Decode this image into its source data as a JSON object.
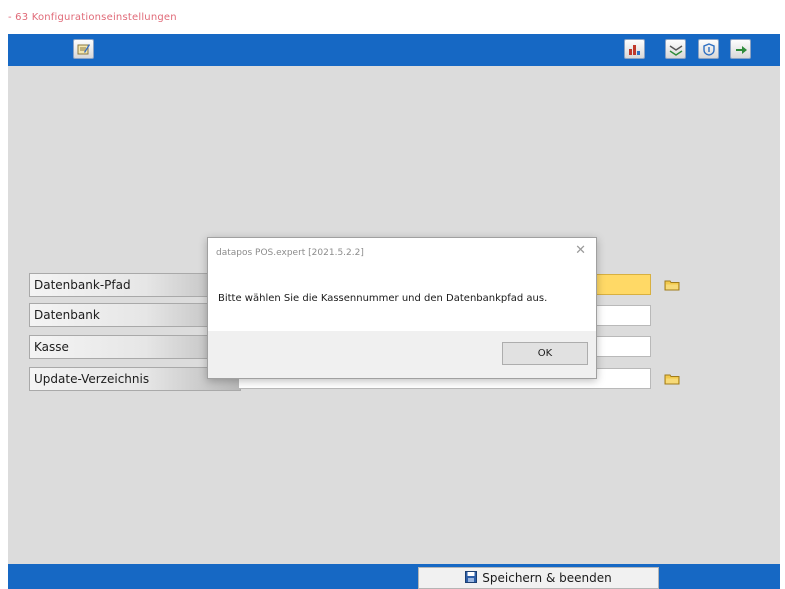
{
  "window": {
    "title": "- 63 Konfigurationseinstellungen"
  },
  "toolbar": {
    "left_icons": [
      "settings-icon"
    ],
    "right_icons": [
      "chart-icon",
      "export-icon",
      "shield-icon",
      "exit-icon"
    ]
  },
  "form": {
    "rows": [
      {
        "label": "Datenbank-Pfad",
        "value": "",
        "highlighted": true,
        "has_browse": true
      },
      {
        "label": "Datenbank",
        "value": "",
        "highlighted": false,
        "has_browse": false
      },
      {
        "label": "Kasse",
        "value": "",
        "highlighted": false,
        "has_browse": false
      },
      {
        "label": "Update-Verzeichnis",
        "value": "",
        "highlighted": false,
        "has_browse": true
      }
    ]
  },
  "footer": {
    "save_label": "Speichern & beenden"
  },
  "dialog": {
    "title": "datapos POS.expert [2021.5.2.2]",
    "close_glyph": "✕",
    "message": "Bitte wählen Sie die Kassennummer und den Datenbankpfad aus.",
    "ok_label": "OK"
  },
  "colors": {
    "accent_blue": "#1668c4",
    "highlight_yellow": "#ffd966",
    "background_gray": "#dcdcdc"
  }
}
